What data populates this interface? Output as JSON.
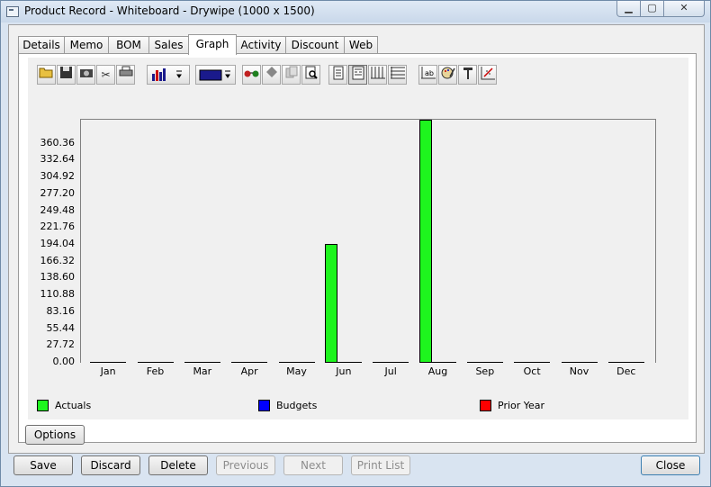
{
  "window": {
    "title": "Product Record - Whiteboard - Drywipe (1000 x 1500)",
    "min_glyph": "▁",
    "max_glyph": "▢",
    "close_glyph": "✕"
  },
  "tabs": [
    {
      "label": "Details",
      "active": false
    },
    {
      "label": "Memo",
      "active": false
    },
    {
      "label": "BOM",
      "active": false
    },
    {
      "label": "Sales",
      "active": false
    },
    {
      "label": "Graph",
      "active": true
    },
    {
      "label": "Activity",
      "active": false
    },
    {
      "label": "Discount",
      "active": false
    },
    {
      "label": "Web",
      "active": false
    }
  ],
  "toolbar": {
    "icons": [
      "open-folder-icon",
      "save-icon",
      "camera-icon",
      "cut-icon",
      "print-icon",
      "bar-chart-type-icon",
      "color-picker-icon",
      "glasses-icon",
      "shape-icon",
      "copy-icon",
      "print-preview-icon",
      "portrait-page-icon",
      "landscape-page-icon",
      "vertical-grid-icon",
      "horizontal-grid-icon",
      "data-labels-icon",
      "palette-icon",
      "tools-icon",
      "axis-settings-icon"
    ],
    "series_color": "#1a1a8c"
  },
  "chart_data": {
    "type": "bar",
    "categories": [
      "Jan",
      "Feb",
      "Mar",
      "Apr",
      "May",
      "Jun",
      "Jul",
      "Aug",
      "Sep",
      "Oct",
      "Nov",
      "Dec"
    ],
    "series": [
      {
        "name": "Actuals",
        "color": "#1ef51e",
        "values": [
          0,
          0,
          0,
          0,
          0,
          194,
          0,
          398,
          0,
          0,
          0,
          0
        ]
      },
      {
        "name": "Budgets",
        "color": "#0000ff",
        "values": [
          0,
          0,
          0,
          0,
          0,
          0,
          0,
          0,
          0,
          0,
          0,
          0
        ]
      },
      {
        "name": "Prior Year",
        "color": "#ff0000",
        "values": [
          0,
          0,
          0,
          0,
          0,
          0,
          0,
          0,
          0,
          0,
          0,
          0
        ]
      }
    ],
    "yticks": [
      "0.00",
      "27.72",
      "55.44",
      "83.16",
      "110.88",
      "138.60",
      "166.32",
      "194.04",
      "221.76",
      "249.48",
      "277.20",
      "304.92",
      "332.64",
      "360.36"
    ],
    "ylim": [
      0,
      400
    ],
    "grid": false,
    "legend_position": "bottom"
  },
  "buttons": {
    "options": "Options",
    "save": "Save",
    "discard": "Discard",
    "delete": "Delete",
    "previous": "Previous",
    "next": "Next",
    "print_list": "Print List",
    "close": "Close"
  }
}
